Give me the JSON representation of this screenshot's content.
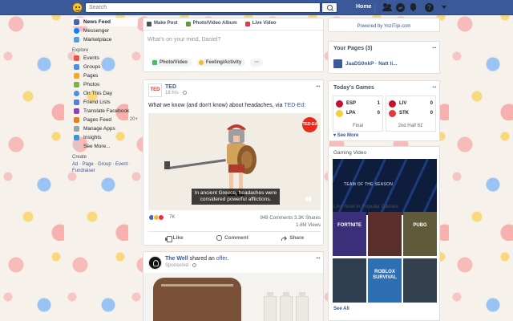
{
  "topbar": {
    "search_placeholder": "Search",
    "home_label": "Home",
    "help_glyph": "?"
  },
  "left_nav": {
    "items": [
      {
        "label": "News Feed",
        "active": true,
        "icon": "news-feed-icon",
        "color": "#4267b2"
      },
      {
        "label": "Messenger",
        "icon": "messenger-icon",
        "color": "#0084ff"
      },
      {
        "label": "Marketplace",
        "icon": "marketplace-icon",
        "color": "#4aa3df"
      }
    ],
    "explore_heading": "Explore",
    "explore_items": [
      {
        "label": "Events",
        "icon": "events-icon",
        "color": "#e9573f"
      },
      {
        "label": "Groups",
        "icon": "groups-icon",
        "color": "#4a90e2"
      },
      {
        "label": "Pages",
        "icon": "pages-icon",
        "color": "#f5a623"
      },
      {
        "label": "Photos",
        "icon": "photos-icon",
        "color": "#7cb342"
      },
      {
        "label": "On This Day",
        "icon": "on-this-day-icon",
        "color": "#4a90e2"
      },
      {
        "label": "Friend Lists",
        "icon": "friend-lists-icon",
        "color": "#5b7bd5"
      },
      {
        "label": "Translate Facebook",
        "icon": "translate-icon",
        "color": "#8e44ad"
      },
      {
        "label": "Pages Feed",
        "count": "20+",
        "icon": "pages-feed-icon",
        "color": "#e67e22"
      },
      {
        "label": "Manage Apps",
        "icon": "manage-apps-icon",
        "color": "#95a5a6"
      },
      {
        "label": "Insights",
        "icon": "insights-icon",
        "color": "#3498db"
      },
      {
        "label": "See More...",
        "icon": "chevron-down-icon",
        "color": "#90949c"
      }
    ],
    "create_heading": "Create",
    "create_links": "Ad · Page · Group · Event · Fundraiser"
  },
  "composer": {
    "tabs": [
      "Make Post",
      "Photo/Video Album",
      "Live Video"
    ],
    "placeholder": "What's on your mind, Daniel?",
    "actions": [
      "Photo/Video",
      "Feeling/Activity"
    ],
    "more": "···"
  },
  "post": {
    "page_name": "TED",
    "avatar_text": "TED",
    "meta": "18 hrs · ",
    "text": "What we know (and don't know) about headaches, via ",
    "link": "TED-Ed",
    "link_suffix": ":",
    "video_badge": "TED-Ed",
    "caption": "In ancient Greece, headaches were considered powerful afflictions.",
    "reaction_count": "7K",
    "comments": "949 Comments",
    "shares": "3.3K Shares",
    "views": "1.6M Views",
    "actions": [
      "Like",
      "Comment",
      "Share"
    ],
    "more": "···"
  },
  "post2": {
    "page_name": "The Well",
    "shared_text": " shared an ",
    "offer_link": "offer",
    "period": ".",
    "sponsored": "Sponsored · "
  },
  "right": {
    "powered_by": "Powered by YoziTipi.com",
    "pages_title": "Your Pages (3)",
    "page_item": "JaaDS0nkP · Natt li...",
    "games_title": "Today's Games",
    "games": [
      {
        "home": "ESP",
        "home_score": "1",
        "away": "LPA",
        "away_score": "0",
        "status": "Final",
        "home_color": "#c8102e",
        "away_color": "#f4d03f"
      },
      {
        "home": "LIV",
        "home_score": "0",
        "away": "STK",
        "away_score": "0",
        "status": "2nd Half 61'",
        "home_color": "#c8102e",
        "away_color": "#e03a3e"
      }
    ],
    "see_more": "See More",
    "gaming_title": "Gaming Video",
    "banner_text": "TEAM OF THE SEASON",
    "live_title": "Live Now in Popular Games",
    "games_tiles": [
      {
        "name": "FORTNITE",
        "color": "#3c2f7a"
      },
      {
        "name": "",
        "color": "#5a2e2a"
      },
      {
        "name": "PUBG",
        "color": "#5f5a3a"
      },
      {
        "name": "",
        "color": "#2c3e50"
      },
      {
        "name": "ROBLOX SURVIVAL",
        "color": "#2e6fb3"
      },
      {
        "name": "",
        "color": "#33414e"
      }
    ],
    "see_all": "See All"
  },
  "colors": {
    "fb_blue": "#3b5998",
    "link_blue": "#365899"
  }
}
